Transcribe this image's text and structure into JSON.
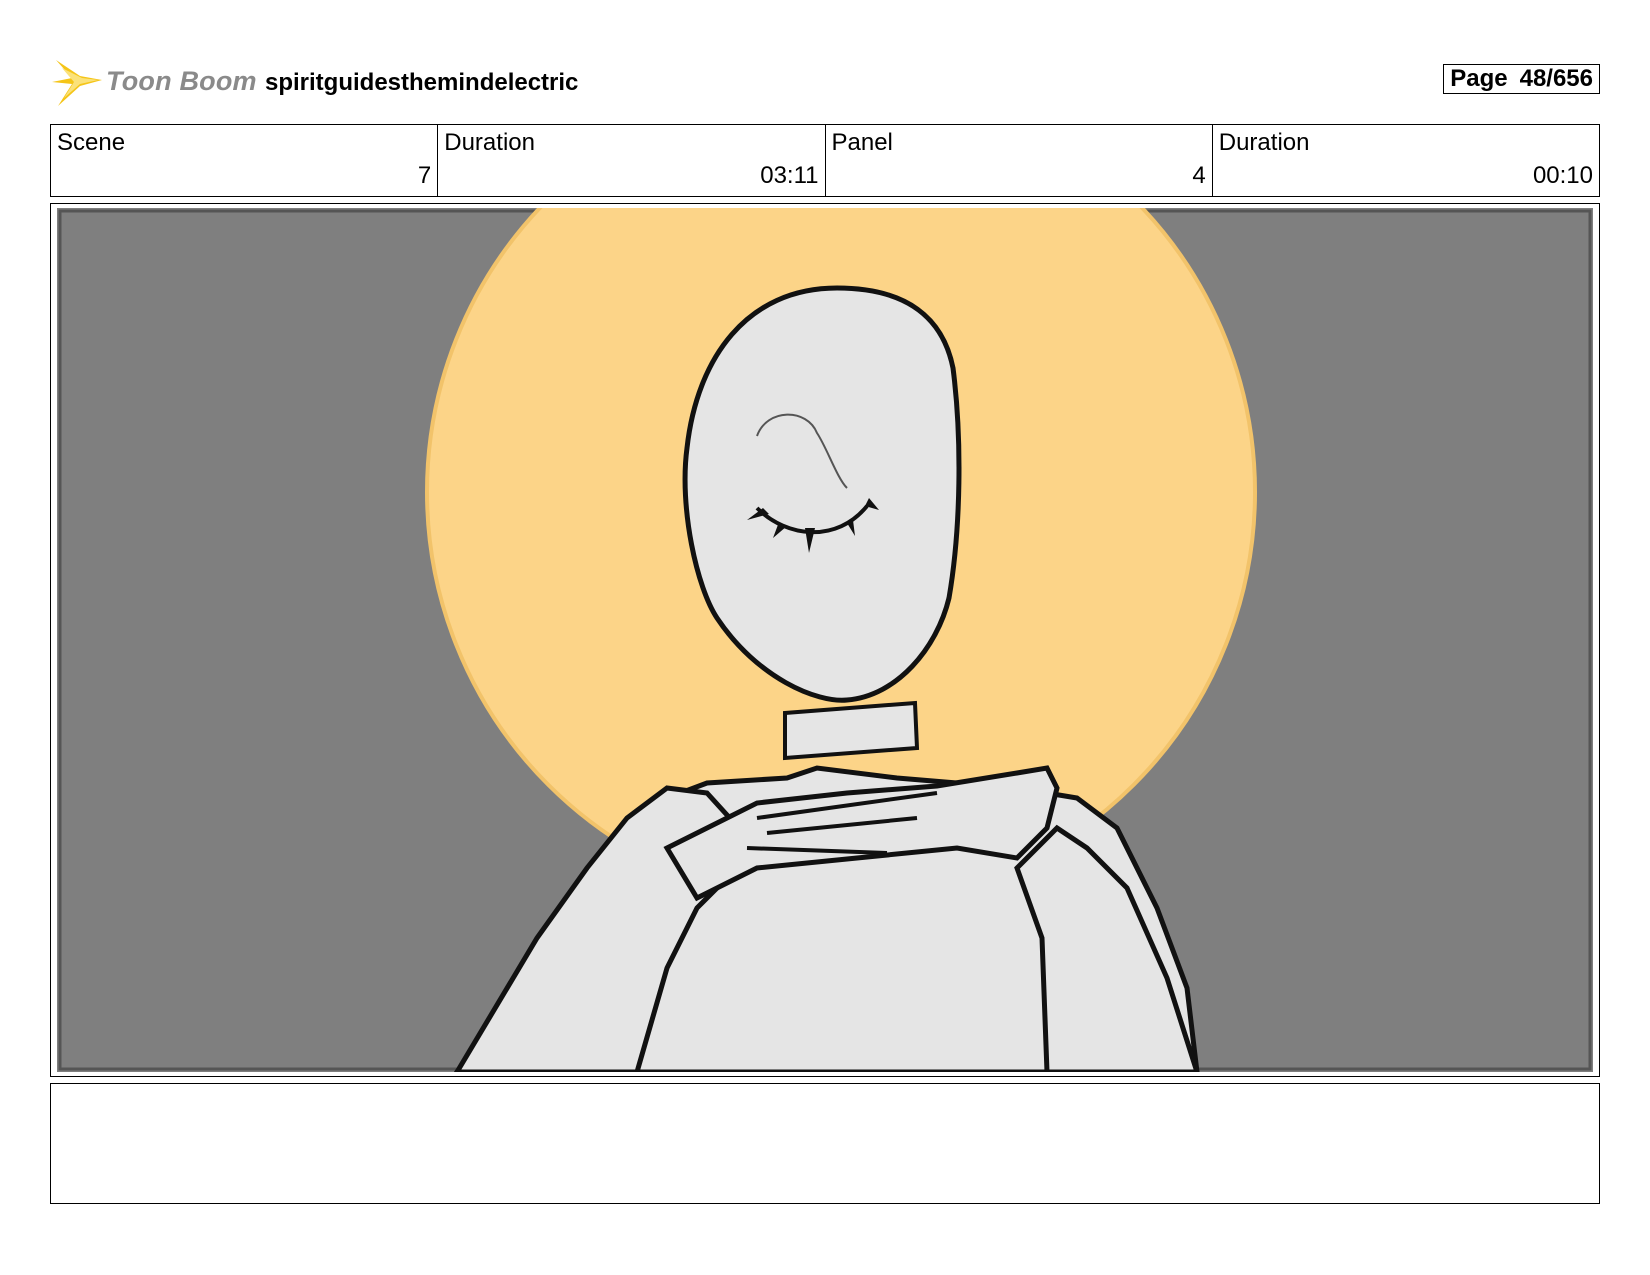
{
  "header": {
    "logo_text": "Toon Boom",
    "project_title": "spiritguidesthemindelectric",
    "page_label": "Page",
    "page_number": "48/656"
  },
  "info": [
    {
      "label": "Scene",
      "value": "7"
    },
    {
      "label": "Duration",
      "value": "03:11"
    },
    {
      "label": "Panel",
      "value": "4"
    },
    {
      "label": "Duration",
      "value": "00:10"
    }
  ],
  "colors": {
    "background": "#7f7f7f",
    "halo": "#fcd488",
    "figure": "#e5e5e5",
    "line": "#111111",
    "logo_accent": "#f5c518"
  },
  "notes": ""
}
